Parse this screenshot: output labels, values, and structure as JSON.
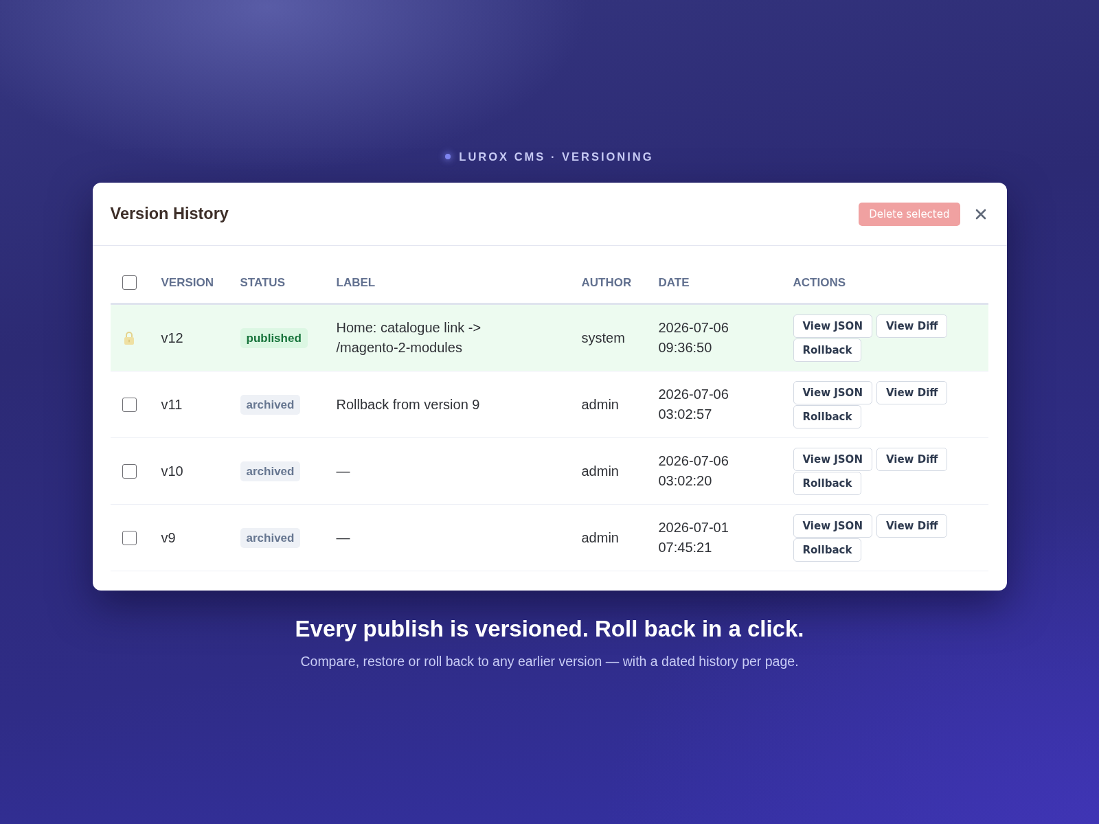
{
  "header": {
    "brand": "LUROX CMS · VERSIONING"
  },
  "dialog": {
    "title": "Version History",
    "delete_button": {
      "label": "Delete selected",
      "disabled": true
    },
    "table": {
      "select_all": {
        "checked": false
      },
      "columns": [
        "VERSION",
        "STATUS",
        "LABEL",
        "AUTHOR",
        "DATE",
        "ACTIONS"
      ],
      "rows": [
        {
          "locked": true,
          "current": true,
          "version": "v12",
          "status": {
            "label": "published",
            "kind": "published"
          },
          "label": "Home: catalogue link -> /magento-2-modules",
          "author": "system",
          "date": "2026-07-06 09:36:50",
          "actions": [
            "View JSON",
            "View Diff",
            "Rollback"
          ]
        },
        {
          "locked": false,
          "checked": false,
          "current": false,
          "version": "v11",
          "status": {
            "label": "archived",
            "kind": "archived"
          },
          "label": "Rollback from version 9",
          "author": "admin",
          "date": "2026-07-06 03:02:57",
          "actions": [
            "View JSON",
            "View Diff",
            "Rollback"
          ]
        },
        {
          "locked": false,
          "checked": false,
          "current": false,
          "version": "v10",
          "status": {
            "label": "archived",
            "kind": "archived"
          },
          "label": "—",
          "author": "admin",
          "date": "2026-07-06 03:02:20",
          "actions": [
            "View JSON",
            "View Diff",
            "Rollback"
          ]
        },
        {
          "locked": false,
          "checked": false,
          "current": false,
          "version": "v9",
          "status": {
            "label": "archived",
            "kind": "archived"
          },
          "label": "—",
          "author": "admin",
          "date": "2026-07-01 07:45:21",
          "actions": [
            "View JSON",
            "View Diff",
            "Rollback"
          ]
        }
      ]
    }
  },
  "tagline": {
    "headline": "Every publish is versioned. Roll back in a click.",
    "subline": "Compare, restore or roll back to any earlier version — with a dated history per page."
  }
}
